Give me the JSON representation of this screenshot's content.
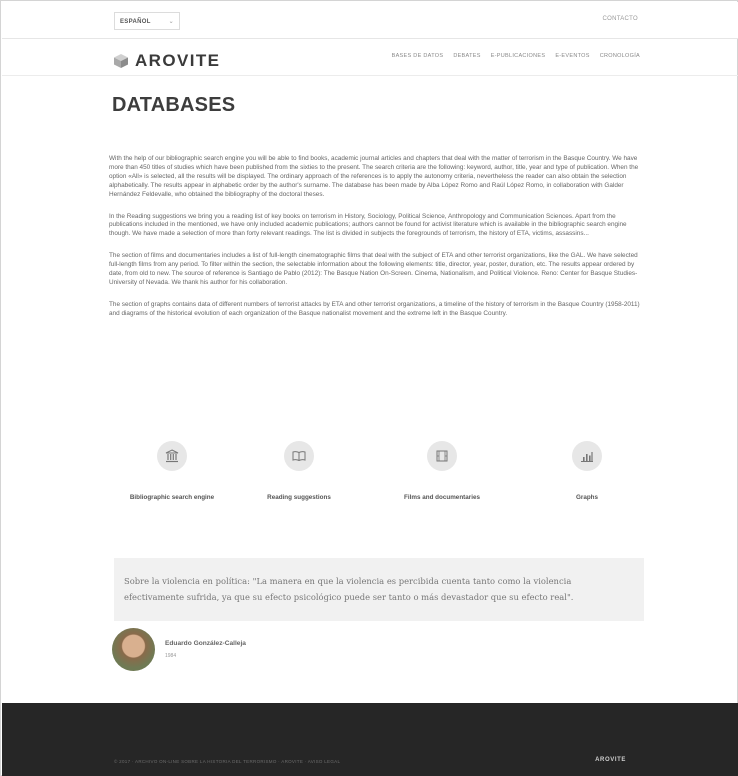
{
  "topbar": {
    "language": "ESPAÑOL",
    "contact": "CONTACTO"
  },
  "header": {
    "logo_text": "AROVITE",
    "nav": [
      "BASES DE DATOS",
      "DEBATES",
      "E-PUBLICACIONES",
      "E-EVENTOS",
      "CRONOLOGÍA"
    ]
  },
  "page": {
    "title": "DATABASES",
    "paragraphs": [
      "With the help of our bibliographic search engine you will be able to find books, academic journal articles and chapters that deal with the matter of terrorism in the Basque Country. We have more than 450 titles of studies which have been published from the sixties to the present. The search criteria are the following: keyword, author, title, year and type of publication. When the option «All» is selected, all the results will be displayed. The ordinary approach of the references is to apply the autonomy criteria, nevertheless the reader can also obtain the selection alphabetically. The results appear in alphabetic order by the author's surname. The database has been made by Alba López Romo and Raúl López Romo, in collaboration with Galder Hernández Feldevalle, who obtained the bibliography of the doctoral theses.",
      "In the Reading suggestions we bring you a reading list of key books on terrorism in History, Sociology, Political Science, Anthropology and Communication Sciences. Apart from the publications included in the mentioned, we have only included academic publications; authors cannot be found for activist literature which is available in the bibliographic search engine though. We have made a selection of more than forty relevant readings. The list is divided in subjects the foregrounds of terrorism, the history of ETA, victims, assassins...",
      "The section of films and documentaries includes a list of full-length cinematographic films that deal with the subject of ETA and other terrorist organizations, like the GAL. We have selected full-length films from any period. To filter within the section, the selectable information about the following elements: title, director, year, poster, duration, etc. The results appear ordered by date, from old to new. The source of reference is Santiago de Pablo (2012): The Basque Nation On-Screen. Cinema, Nationalism, and Political Violence. Reno: Center for Basque Studies-University of Nevada. We thank his author for his collaboration.",
      "The section of graphs contains data of different numbers of terrorist attacks by ETA and other terrorist organizations, a timeline of the history of terrorism in the Basque Country (1958-2011) and diagrams of the historical evolution of each organization of the Basque nationalist movement and the extreme left in the Basque Country."
    ]
  },
  "features": [
    {
      "label": "Bibliographic search engine",
      "icon": "library-icon"
    },
    {
      "label": "Reading suggestions",
      "icon": "book-icon"
    },
    {
      "label": "Films and documentaries",
      "icon": "film-icon"
    },
    {
      "label": "Graphs",
      "icon": "bar-chart-icon"
    }
  ],
  "quote": {
    "text": "Sobre la violencia en política: \"La manera en que la violencia es percibida cuenta tanto como la violencia efectivamente sufrida, ya que su efecto psicológico puede ser tanto o más devastador que su efecto real\".",
    "author": "Eduardo González-Calleja",
    "years": "1984"
  },
  "footer": {
    "copyright": "© 2017 · ARCHIVO ON-LINE SOBRE LA HISTORIA DEL TERRORISMO · AROVITE · AVISO LEGAL",
    "logo": "AROVITE"
  },
  "colors": {
    "footer_bg": "#262626",
    "quote_bg": "#f1f1f1",
    "icon_circle": "#e7e7e7"
  }
}
